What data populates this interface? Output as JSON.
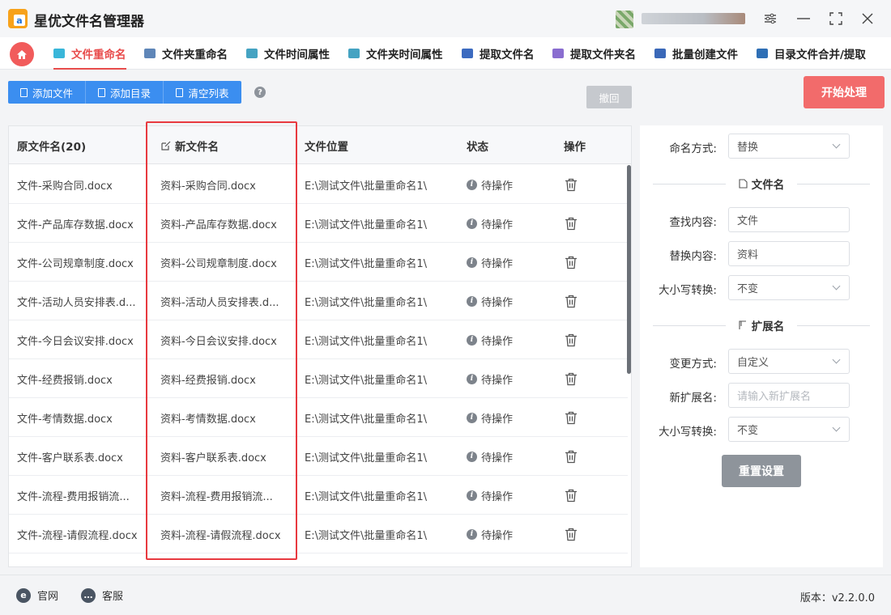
{
  "app": {
    "title": "星优文件名管理器"
  },
  "window_controls": {
    "settings": "≡",
    "minimize": "—",
    "maximize": "⛶",
    "close": "✕"
  },
  "nav": {
    "tabs": [
      {
        "label": "文件重命名",
        "active": true,
        "icon": "rename-file-icon"
      },
      {
        "label": "文件夹重命名",
        "icon": "rename-folder-icon"
      },
      {
        "label": "文件时间属性",
        "icon": "file-time-icon"
      },
      {
        "label": "文件夹时间属性",
        "icon": "folder-time-icon"
      },
      {
        "label": "提取文件名",
        "icon": "extract-filename-icon"
      },
      {
        "label": "提取文件夹名",
        "icon": "extract-foldername-icon"
      },
      {
        "label": "批量创建文件",
        "icon": "batch-create-icon"
      },
      {
        "label": "目录文件合并/提取",
        "icon": "merge-extract-icon"
      }
    ]
  },
  "toolbar": {
    "add_file": "添加文件",
    "add_dir": "添加目录",
    "clear_list": "清空列表",
    "help": "?",
    "undo": "撤回",
    "start": "开始处理"
  },
  "table": {
    "headers": {
      "original": "原文件名(20)",
      "new_name": "新文件名",
      "location": "文件位置",
      "status": "状态",
      "action": "操作"
    },
    "rows": [
      {
        "original": "文件-采购合同.docx",
        "new_name": "资料-采购合同.docx",
        "location": "E:\\测试文件\\批量重命名1\\",
        "status": "待操作"
      },
      {
        "original": "文件-产品库存数据.docx",
        "new_name": "资料-产品库存数据.docx",
        "location": "E:\\测试文件\\批量重命名1\\",
        "status": "待操作"
      },
      {
        "original": "文件-公司规章制度.docx",
        "new_name": "资料-公司规章制度.docx",
        "location": "E:\\测试文件\\批量重命名1\\",
        "status": "待操作"
      },
      {
        "original": "文件-活动人员安排表.d...",
        "new_name": "资料-活动人员安排表.d...",
        "location": "E:\\测试文件\\批量重命名1\\",
        "status": "待操作"
      },
      {
        "original": "文件-今日会议安排.docx",
        "new_name": "资料-今日会议安排.docx",
        "location": "E:\\测试文件\\批量重命名1\\",
        "status": "待操作"
      },
      {
        "original": "文件-经费报销.docx",
        "new_name": "资料-经费报销.docx",
        "location": "E:\\测试文件\\批量重命名1\\",
        "status": "待操作"
      },
      {
        "original": "文件-考情数据.docx",
        "new_name": "资料-考情数据.docx",
        "location": "E:\\测试文件\\批量重命名1\\",
        "status": "待操作"
      },
      {
        "original": "文件-客户联系表.docx",
        "new_name": "资料-客户联系表.docx",
        "location": "E:\\测试文件\\批量重命名1\\",
        "status": "待操作"
      },
      {
        "original": "文件-流程-费用报销流...",
        "new_name": "资料-流程-费用报销流...",
        "location": "E:\\测试文件\\批量重命名1\\",
        "status": "待操作"
      },
      {
        "original": "文件-流程-请假流程.docx",
        "new_name": "资料-流程-请假流程.docx",
        "location": "E:\\测试文件\\批量重命名1\\",
        "status": "待操作"
      }
    ]
  },
  "panel": {
    "naming_mode_label": "命名方式:",
    "naming_mode_value": "替换",
    "filename_section": "文件名",
    "find_label": "查找内容:",
    "find_value": "文件",
    "replace_label": "替换内容:",
    "replace_value": "资料",
    "case_label": "大小写转换:",
    "case_value": "不变",
    "ext_section": "扩展名",
    "change_mode_label": "变更方式:",
    "change_mode_value": "自定义",
    "new_ext_label": "新扩展名:",
    "new_ext_placeholder": "请输入新扩展名",
    "ext_case_label": "大小写转换:",
    "ext_case_value": "不变",
    "reset": "重置设置"
  },
  "footer": {
    "website": "官网",
    "support": "客服",
    "version": "版本：v2.2.0.0"
  },
  "colors": {
    "accent_red": "#e84c4c",
    "primary_blue": "#3b8ef0",
    "start_red": "#f26b6b"
  }
}
